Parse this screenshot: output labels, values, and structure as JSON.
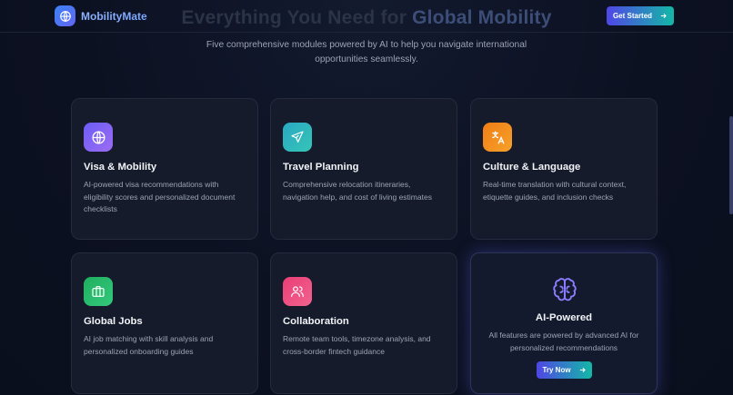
{
  "header": {
    "brand_name": "MobilityMate",
    "cta_label": "Get Started"
  },
  "hero": {
    "title_main": "Everything You Need for ",
    "title_accent": "Global Mobility",
    "subtitle": "Five comprehensive modules powered by AI to help you navigate international opportunities seamlessly."
  },
  "modules": [
    {
      "title": "Visa & Mobility",
      "description": "AI-powered visa recommendations with eligibility scores and personalized document checklists",
      "icon": "globe-icon",
      "color": "#7c5cf5"
    },
    {
      "title": "Travel Planning",
      "description": "Comprehensive relocation itineraries, navigation help, and cost of living estimates",
      "icon": "plane-icon",
      "color": "#2fb8c1"
    },
    {
      "title": "Culture & Language",
      "description": "Real-time translation with cultural context, etiquette guides, and inclusion checks",
      "icon": "translate-icon",
      "color": "#f28c1b"
    },
    {
      "title": "Global Jobs",
      "description": "AI job matching with skill analysis and personalized onboarding guides",
      "icon": "briefcase-icon",
      "color": "#22b76a"
    },
    {
      "title": "Collaboration",
      "description": "Remote team tools, timezone analysis, and cross-border fintech guidance",
      "icon": "users-icon",
      "color": "#ee4b7e"
    }
  ],
  "ai_card": {
    "title": "AI-Powered",
    "description": "All features are powered by advanced AI for personalized recommendations",
    "button_label": "Try Now",
    "icon": "brain-icon",
    "color": "#8b7cff"
  }
}
